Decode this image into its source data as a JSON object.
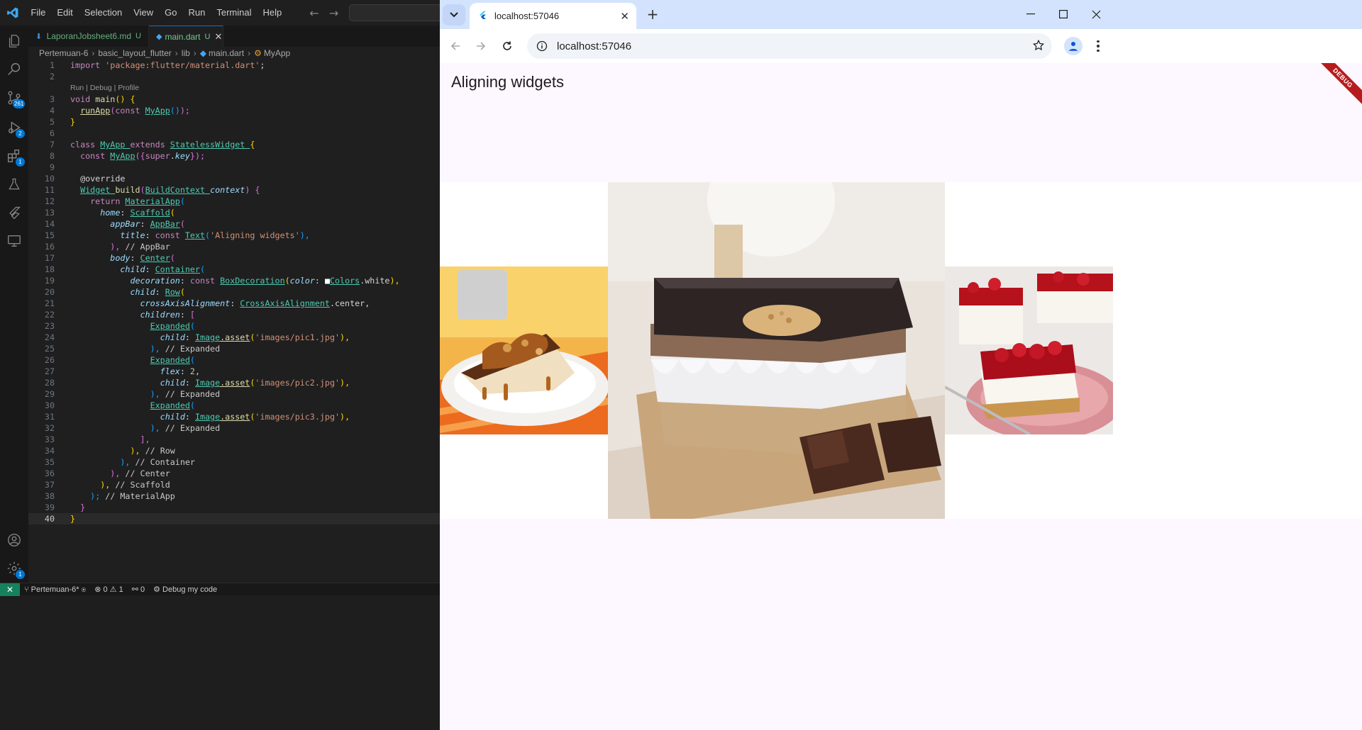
{
  "vscode": {
    "menu": [
      "File",
      "Edit",
      "Selection",
      "View",
      "Go",
      "Run",
      "Terminal",
      "Help"
    ],
    "activity_badges": {
      "source_control": "261",
      "run_debug": "2",
      "extensions": "1",
      "settings": "1"
    },
    "tabs": [
      {
        "label": "LaporanJobsheet6.md",
        "status": "U"
      },
      {
        "label": "main.dart",
        "status": "U"
      }
    ],
    "breadcrumb": [
      "Pertemuan-6",
      "basic_layout_flutter",
      "lib",
      "main.dart",
      "MyApp"
    ],
    "codelens": "Run | Debug | Profile",
    "status": {
      "branch": "Pertemuan-6*",
      "errors": "0",
      "warnings": "1",
      "ports": "0",
      "debug": "Debug my code"
    }
  },
  "browser": {
    "tab_title": "localhost:57046",
    "url": "localhost:57046",
    "page": {
      "appbar_title": "Aligning widgets",
      "debug_banner": "DEBUG"
    }
  },
  "colors": {
    "vscode_bg": "#1f1f1f",
    "accent": "#0078d4",
    "chrome_tabbar": "#d3e3fd",
    "flutter_bg": "#fdf7ff"
  }
}
